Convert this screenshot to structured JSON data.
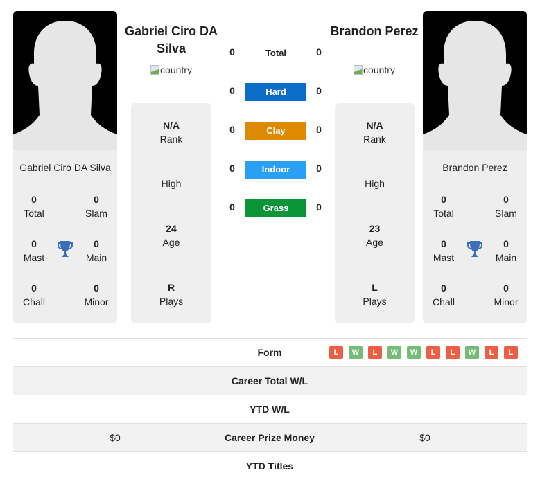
{
  "colors": {
    "hard": "#0a6ec8",
    "clay": "#dd8a00",
    "indoor": "#2aa0f5",
    "grass": "#0c9438",
    "loss": "#ee5e45",
    "win": "#76bb76",
    "trophy": "#3a6fb8"
  },
  "player1": {
    "name": "Gabriel Ciro DA Silva",
    "flag_alt": "country",
    "card_name": "Gabriel Ciro DA Silva",
    "titles": {
      "total": {
        "value": "0",
        "label": "Total"
      },
      "slam": {
        "value": "0",
        "label": "Slam"
      },
      "mast": {
        "value": "0",
        "label": "Mast"
      },
      "main": {
        "value": "0",
        "label": "Main"
      },
      "chall": {
        "value": "0",
        "label": "Chall"
      },
      "minor": {
        "value": "0",
        "label": "Minor"
      }
    },
    "info": {
      "rank": {
        "value": "N/A",
        "label": "Rank"
      },
      "high": {
        "value": "",
        "label": "High"
      },
      "age": {
        "value": "24",
        "label": "Age"
      },
      "plays": {
        "value": "R",
        "label": "Plays"
      }
    }
  },
  "player2": {
    "name": "Brandon Perez",
    "flag_alt": "country",
    "card_name": "Brandon Perez",
    "titles": {
      "total": {
        "value": "0",
        "label": "Total"
      },
      "slam": {
        "value": "0",
        "label": "Slam"
      },
      "mast": {
        "value": "0",
        "label": "Mast"
      },
      "main": {
        "value": "0",
        "label": "Main"
      },
      "chall": {
        "value": "0",
        "label": "Chall"
      },
      "minor": {
        "value": "0",
        "label": "Minor"
      }
    },
    "info": {
      "rank": {
        "value": "N/A",
        "label": "Rank"
      },
      "high": {
        "value": "",
        "label": "High"
      },
      "age": {
        "value": "23",
        "label": "Age"
      },
      "plays": {
        "value": "L",
        "label": "Plays"
      }
    }
  },
  "h2h": {
    "total": {
      "label": "Total",
      "p1": "0",
      "p2": "0"
    },
    "surfaces": [
      {
        "label": "Hard",
        "p1": "0",
        "p2": "0"
      },
      {
        "label": "Clay",
        "p1": "0",
        "p2": "0"
      },
      {
        "label": "Indoor",
        "p1": "0",
        "p2": "0"
      },
      {
        "label": "Grass",
        "p1": "0",
        "p2": "0"
      }
    ]
  },
  "table": {
    "form": {
      "label": "Form",
      "p2_results": [
        "L",
        "W",
        "L",
        "W",
        "W",
        "L",
        "L",
        "W",
        "L",
        "L"
      ]
    },
    "career_wl": {
      "label": "Career Total W/L",
      "p1": "",
      "p2": ""
    },
    "ytd_wl": {
      "label": "YTD W/L",
      "p1": "",
      "p2": ""
    },
    "prize_money": {
      "label": "Career Prize Money",
      "p1": "$0",
      "p2": "$0"
    },
    "ytd_titles": {
      "label": "YTD Titles",
      "p1": "",
      "p2": ""
    }
  }
}
